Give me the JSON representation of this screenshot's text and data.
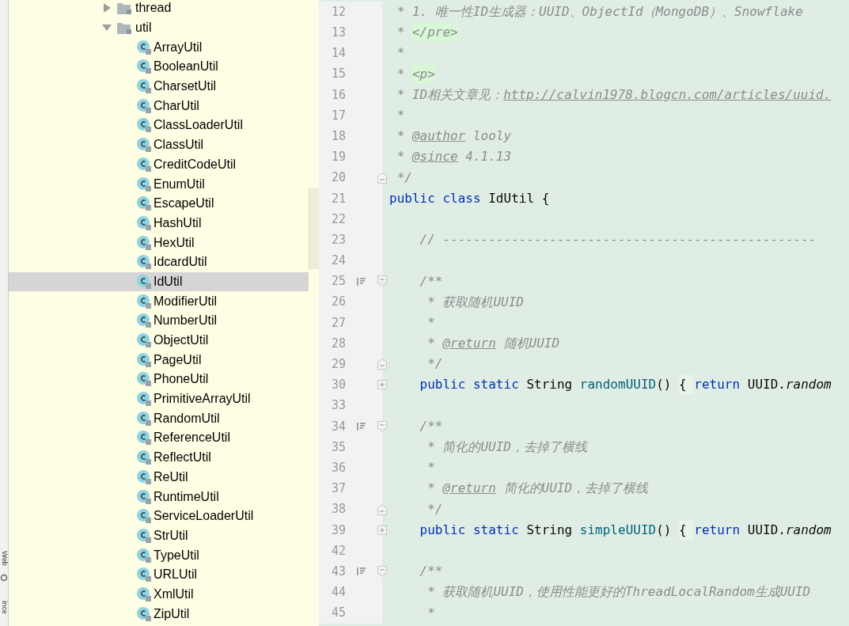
{
  "side_tabs": [
    {
      "label": "Web"
    },
    {
      "label": "ince"
    }
  ],
  "tree": [
    {
      "label": "thread",
      "kind": "folder",
      "expanded": false,
      "selected": false
    },
    {
      "label": "util",
      "kind": "folder",
      "expanded": true,
      "selected": false,
      "children": [
        {
          "label": "ArrayUtil",
          "kind": "class",
          "selected": false
        },
        {
          "label": "BooleanUtil",
          "kind": "class",
          "selected": false
        },
        {
          "label": "CharsetUtil",
          "kind": "class",
          "selected": false
        },
        {
          "label": "CharUtil",
          "kind": "class",
          "selected": false
        },
        {
          "label": "ClassLoaderUtil",
          "kind": "class",
          "selected": false
        },
        {
          "label": "ClassUtil",
          "kind": "class",
          "selected": false
        },
        {
          "label": "CreditCodeUtil",
          "kind": "class",
          "selected": false
        },
        {
          "label": "EnumUtil",
          "kind": "class",
          "selected": false
        },
        {
          "label": "EscapeUtil",
          "kind": "class",
          "selected": false
        },
        {
          "label": "HashUtil",
          "kind": "class",
          "selected": false
        },
        {
          "label": "HexUtil",
          "kind": "class",
          "selected": false
        },
        {
          "label": "IdcardUtil",
          "kind": "class",
          "selected": false
        },
        {
          "label": "IdUtil",
          "kind": "class",
          "selected": true
        },
        {
          "label": "ModifierUtil",
          "kind": "class",
          "selected": false
        },
        {
          "label": "NumberUtil",
          "kind": "class",
          "selected": false
        },
        {
          "label": "ObjectUtil",
          "kind": "class",
          "selected": false
        },
        {
          "label": "PageUtil",
          "kind": "class",
          "selected": false
        },
        {
          "label": "PhoneUtil",
          "kind": "class",
          "selected": false
        },
        {
          "label": "PrimitiveArrayUtil",
          "kind": "class",
          "selected": false
        },
        {
          "label": "RandomUtil",
          "kind": "class",
          "selected": false
        },
        {
          "label": "ReferenceUtil",
          "kind": "class",
          "selected": false
        },
        {
          "label": "ReflectUtil",
          "kind": "class",
          "selected": false
        },
        {
          "label": "ReUtil",
          "kind": "class",
          "selected": false
        },
        {
          "label": "RuntimeUtil",
          "kind": "class",
          "selected": false
        },
        {
          "label": "ServiceLoaderUtil",
          "kind": "class",
          "selected": false
        },
        {
          "label": "StrUtil",
          "kind": "class",
          "selected": false
        },
        {
          "label": "TypeUtil",
          "kind": "class",
          "selected": false
        },
        {
          "label": "URLUtil",
          "kind": "class",
          "selected": false
        },
        {
          "label": "XmlUtil",
          "kind": "class",
          "selected": false
        },
        {
          "label": "ZipUtil",
          "kind": "class",
          "selected": false
        }
      ]
    }
  ],
  "editor": {
    "lines": [
      {
        "number": "12",
        "tokens": [
          {
            "kind": "comment",
            "text": " * 1. 唯一性ID生成器：UUID、ObjectId（MongoDB）、Snowflake"
          }
        ]
      },
      {
        "number": "13",
        "tokens": [
          {
            "kind": "comment",
            "text": " * "
          },
          {
            "kind": "tag",
            "text": "</pre>"
          }
        ]
      },
      {
        "number": "14",
        "tokens": [
          {
            "kind": "comment",
            "text": " *"
          }
        ]
      },
      {
        "number": "15",
        "tokens": [
          {
            "kind": "comment",
            "text": " * "
          },
          {
            "kind": "tag",
            "text": "<p>"
          }
        ]
      },
      {
        "number": "16",
        "tokens": [
          {
            "kind": "comment",
            "text": " * ID相关文章见："
          },
          {
            "kind": "link",
            "text": "http://calvin1978.blogcn.com/articles/uuid."
          }
        ]
      },
      {
        "number": "17",
        "tokens": [
          {
            "kind": "comment",
            "text": " *"
          }
        ]
      },
      {
        "number": "18",
        "tokens": [
          {
            "kind": "comment",
            "text": " * "
          },
          {
            "kind": "doctag",
            "text": "@author"
          },
          {
            "kind": "comment",
            "text": " looly"
          }
        ]
      },
      {
        "number": "19",
        "tokens": [
          {
            "kind": "comment",
            "text": " * "
          },
          {
            "kind": "doctag",
            "text": "@since"
          },
          {
            "kind": "comment",
            "text": " 4.1.13"
          }
        ]
      },
      {
        "number": "20",
        "fold_end": true,
        "tokens": [
          {
            "kind": "comment",
            "text": " */"
          }
        ]
      },
      {
        "number": "21",
        "tokens": [
          {
            "kind": "keyword",
            "text": "public class "
          },
          {
            "kind": "plain",
            "text": "IdUtil {"
          }
        ]
      },
      {
        "number": "22"
      },
      {
        "number": "23",
        "tokens": [
          {
            "kind": "comment",
            "text": "    // -------------------------------------------------"
          }
        ]
      },
      {
        "number": "24"
      },
      {
        "number": "25",
        "gutter_mark": true,
        "fold_start": true,
        "tokens": [
          {
            "kind": "comment",
            "text": "    /**"
          }
        ]
      },
      {
        "number": "26",
        "tokens": [
          {
            "kind": "comment",
            "text": "     * 获取随机UUID"
          }
        ]
      },
      {
        "number": "27",
        "tokens": [
          {
            "kind": "comment",
            "text": "     *"
          }
        ]
      },
      {
        "number": "28",
        "tokens": [
          {
            "kind": "comment",
            "text": "     * "
          },
          {
            "kind": "doctag",
            "text": "@return"
          },
          {
            "kind": "comment",
            "text": " 随机UUID"
          }
        ]
      },
      {
        "number": "29",
        "fold_end": true,
        "tokens": [
          {
            "kind": "comment",
            "text": "     */"
          }
        ]
      },
      {
        "number": "30",
        "fold_collapsed": true,
        "tokens": [
          {
            "kind": "keyword",
            "text": "    public static "
          },
          {
            "kind": "plain",
            "text": "String "
          },
          {
            "kind": "method",
            "text": "randomUUID"
          },
          {
            "kind": "plain",
            "text": "() "
          },
          {
            "kind": "folded",
            "text": "{ "
          },
          {
            "kind": "keyword",
            "text": "return "
          },
          {
            "kind": "plain",
            "text": "UUID."
          },
          {
            "kind": "static_call",
            "text": "random"
          }
        ]
      },
      {
        "number": "33"
      },
      {
        "number": "34",
        "gutter_mark": true,
        "fold_start": true,
        "tokens": [
          {
            "kind": "comment",
            "text": "    /**"
          }
        ]
      },
      {
        "number": "35",
        "tokens": [
          {
            "kind": "comment",
            "text": "     * 简化的UUID，去掉了横线"
          }
        ]
      },
      {
        "number": "36",
        "tokens": [
          {
            "kind": "comment",
            "text": "     *"
          }
        ]
      },
      {
        "number": "37",
        "tokens": [
          {
            "kind": "comment",
            "text": "     * "
          },
          {
            "kind": "doctag",
            "text": "@return"
          },
          {
            "kind": "comment",
            "text": " 简化的UUID，去掉了横线"
          }
        ]
      },
      {
        "number": "38",
        "fold_end": true,
        "tokens": [
          {
            "kind": "comment",
            "text": "     */"
          }
        ]
      },
      {
        "number": "39",
        "fold_collapsed": true,
        "tokens": [
          {
            "kind": "keyword",
            "text": "    public static "
          },
          {
            "kind": "plain",
            "text": "String "
          },
          {
            "kind": "method",
            "text": "simpleUUID"
          },
          {
            "kind": "plain",
            "text": "() "
          },
          {
            "kind": "folded",
            "text": "{ "
          },
          {
            "kind": "keyword",
            "text": "return "
          },
          {
            "kind": "plain",
            "text": "UUID."
          },
          {
            "kind": "static_call",
            "text": "random"
          }
        ]
      },
      {
        "number": "42"
      },
      {
        "number": "43",
        "gutter_mark": true,
        "fold_start": true,
        "tokens": [
          {
            "kind": "comment",
            "text": "    /**"
          }
        ]
      },
      {
        "number": "44",
        "tokens": [
          {
            "kind": "comment",
            "text": "     * 获取随机UUID，使用性能更好的ThreadLocalRandom生成UUID"
          }
        ]
      },
      {
        "number": "45",
        "tokens": [
          {
            "kind": "comment",
            "text": "     *"
          }
        ]
      }
    ]
  }
}
